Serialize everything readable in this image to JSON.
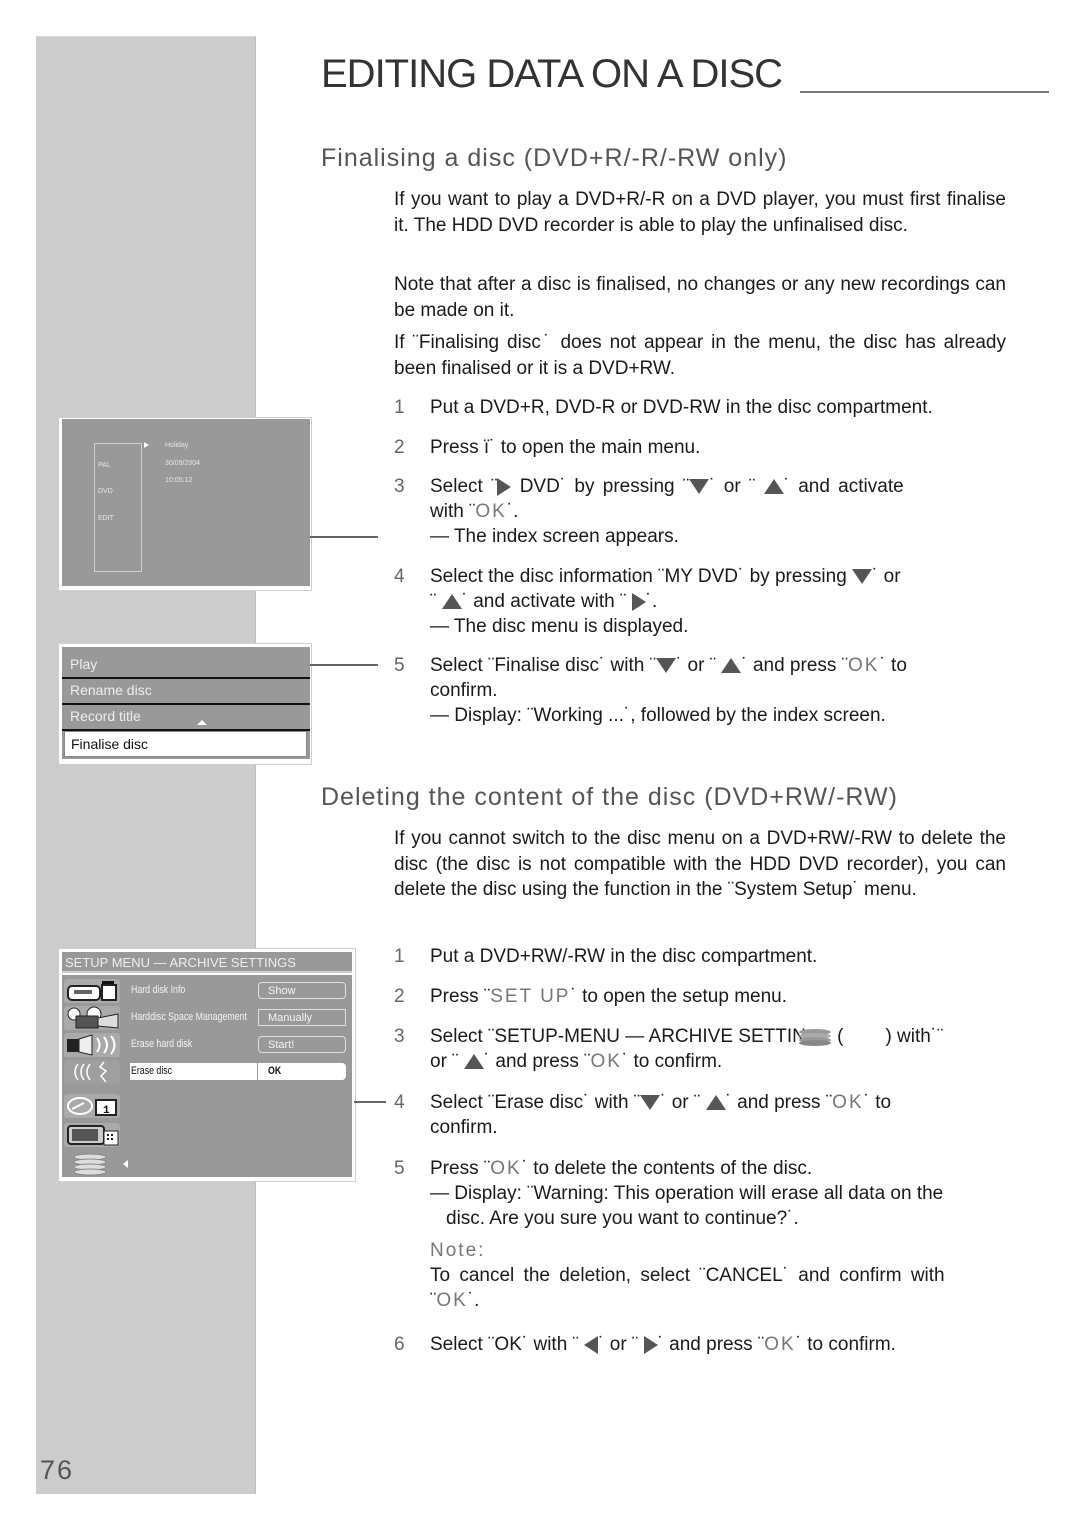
{
  "page": {
    "title": "EDITING DATA ON A DISC",
    "page_number": "76"
  },
  "section1": {
    "heading": "Finalising a disc (DVD+R/-R/-RW only)",
    "paragraphs": [
      "If you want to play a DVD+R/-R on a DVD player, you must first finalise it. The HDD DVD recorder is able to play the unfinalised disc.",
      "Note that after a disc is finalised, no changes or any new recordings can be made on it.",
      "If ¨Finalising disc˙ does not appear in the menu, the disc has already been finalised or it is a DVD+RW."
    ],
    "steps": [
      {
        "num": "1",
        "lines": [
          "Put a DVD+R, DVD-R or DVD-RW in the disc compartment."
        ]
      },
      {
        "num": "2",
        "a": "Press ",
        "key": "ï˙",
        "b": " to open the main menu."
      },
      {
        "num": "3",
        "a": "Select ¨",
        "b": " DVD˙ by pressing ¨",
        "c": "˙ or ¨ ",
        "d": "˙ and activate",
        "e": "with ¨",
        "key": "OK",
        "f": "˙.",
        "result": "— The index screen appears."
      },
      {
        "num": "4",
        "a": "Select the disc information ¨MY DVD˙ by pressing ",
        "b": "˙ or",
        "c": "¨ ",
        "d": "˙ and activate with ¨ ",
        "e": "˙.",
        "result": "— The disc menu is displayed."
      },
      {
        "num": "5",
        "a": "Select ¨Finalise disc˙ with ¨",
        "b": "˙ or ¨ ",
        "c": "˙ and press ¨",
        "key": "OK",
        "d": "˙ to",
        "e": "confirm.",
        "result": "— Display: ¨Working ...˙, followed by the index screen."
      }
    ]
  },
  "section2": {
    "heading": "Deleting the content of the disc (DVD+RW/-RW)",
    "paragraph": "If you cannot switch to the disc menu on a DVD+RW/-RW to delete the disc (the disc is not compatible with the HDD DVD recorder), you can delete the disc using the function in the ¨System Setup˙ menu.",
    "steps": [
      {
        "num": "1",
        "text": "Put a DVD+RW/-RW in the disc compartment."
      },
      {
        "num": "2",
        "a": "Press ¨",
        "key": "SET UP",
        "b": "˙ to open the setup menu."
      },
      {
        "num": "3",
        "a": "Select ¨SETUP-MENU — ARCHIVE SETTIN",
        "b": " (",
        "c": ") with˙¨",
        "d": "or ¨ ",
        "e": "˙ and press ¨",
        "key": "OK",
        "f": "˙ to confirm."
      },
      {
        "num": "4",
        "a": "Select ¨Erase disc˙ with ¨",
        "b": "˙ or ¨ ",
        "c": "˙ and press ¨",
        "key": "OK",
        "d": "˙ to",
        "e": "confirm."
      },
      {
        "num": "5",
        "a": "Press ¨",
        "key": "OK",
        "b": "˙ to delete the contents of the disc.",
        "result1": "— Display: ¨Warning: This operation will erase all data on the",
        "result2": "disc. Are you sure you want to continue?˙.",
        "note_label": "Note:",
        "note1": "To cancel the deletion, select ¨CANCEL˙ and confirm with",
        "note2a": "¨",
        "note2key": "OK",
        "note2b": "˙."
      },
      {
        "num": "6",
        "a": "Select ¨OK˙ with ¨ ",
        "b": "˙ or ¨ ",
        "c": "˙ and press ¨",
        "key": "OK",
        "d": "˙ to confirm."
      }
    ]
  },
  "index_screen": {
    "left_items": [
      "PAL",
      "DVD",
      "EDIT"
    ],
    "title": "Holiday",
    "date": "30/09/2004",
    "time": "10:05:12"
  },
  "disc_menu": {
    "items": [
      "Play",
      "Rename disc",
      "Record title",
      "Finalise disc"
    ],
    "selected": "Finalise disc"
  },
  "setup_menu": {
    "header": "SETUP MENU — ARCHIVE SETTINGS",
    "rows": [
      {
        "label": "Hard disk Info",
        "value": "Show"
      },
      {
        "label": "Harddisc Space Management",
        "value": "Manually"
      },
      {
        "label": "Erase hard disk",
        "value": "Start!"
      },
      {
        "label": "Erase disc",
        "value": "OK"
      }
    ],
    "selected": "Erase disc",
    "icons": [
      "camcorder-icon",
      "projector-icon",
      "speaker-icon",
      "signal-icon",
      "timer-icon",
      "tv-icon",
      "disc-stack-icon"
    ]
  },
  "colors": {
    "sidebar": "#cccccc",
    "screen_bg": "#999999",
    "key_text": "#777777"
  }
}
